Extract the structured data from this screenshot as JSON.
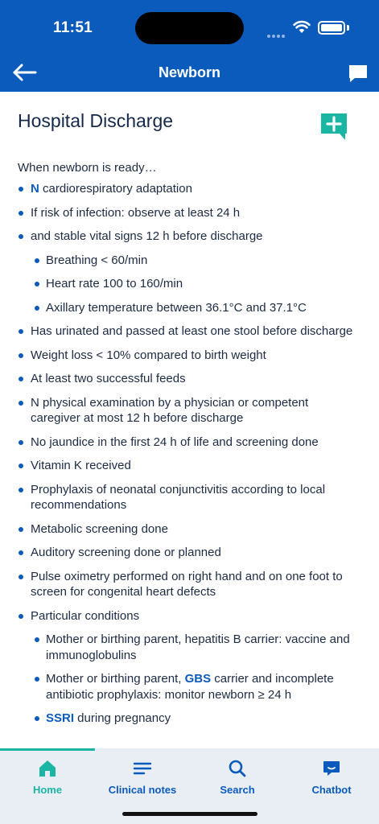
{
  "status_bar": {
    "time": "11:51"
  },
  "nav": {
    "title": "Newborn"
  },
  "page": {
    "title": "Hospital Discharge",
    "intro": "When newborn is ready…",
    "items": [
      {
        "level": 1,
        "keyword": "N",
        "text": " cardiorespiratory adaptation"
      },
      {
        "level": 1,
        "text": "If risk of infection: observe at least 24 h"
      },
      {
        "level": 1,
        "text": "and stable vital signs 12 h before discharge"
      },
      {
        "level": 2,
        "text": "Breathing < 60/min"
      },
      {
        "level": 2,
        "text": "Heart rate 100 to 160/min"
      },
      {
        "level": 2,
        "text": "Axillary temperature between 36.1°C and 37.1°C"
      },
      {
        "level": 1,
        "text": "Has urinated and passed at least one stool before discharge"
      },
      {
        "level": 1,
        "text": "Weight loss < 10% compared to birth weight"
      },
      {
        "level": 1,
        "text": "At least two successful feeds"
      },
      {
        "level": 1,
        "text": "N physical examination by a physician or competent caregiver at most 12 h before discharge"
      },
      {
        "level": 1,
        "text": "No jaundice in the first 24 h of life and screening done"
      },
      {
        "level": 1,
        "text": "Vitamin K received"
      },
      {
        "level": 1,
        "text": "Prophylaxis of neonatal conjunctivitis according to local recommendations"
      },
      {
        "level": 1,
        "text": "Metabolic screening done"
      },
      {
        "level": 1,
        "text": "Auditory screening done or planned"
      },
      {
        "level": 1,
        "text": "Pulse oximetry performed on right hand and on one foot to screen for congenital heart defects"
      },
      {
        "level": 1,
        "text": "Particular conditions"
      },
      {
        "level": 2,
        "text": "Mother or birthing parent, hepatitis B carrier: vaccine and immunoglobulins"
      },
      {
        "level": 2,
        "prefix": "Mother or birthing parent, ",
        "keyword": "GBS",
        "text": " carrier and incomplete antibiotic prophylaxis: monitor newborn ≥ 24 h"
      },
      {
        "level": 2,
        "keyword": "SSRI",
        "text": " during pregnancy"
      }
    ]
  },
  "tabs": [
    {
      "label": "Home",
      "icon": "home-icon",
      "active": true
    },
    {
      "label": "Clinical notes",
      "icon": "notes-icon",
      "active": false
    },
    {
      "label": "Search",
      "icon": "search-icon",
      "active": false
    },
    {
      "label": "Chatbot",
      "icon": "chat-icon",
      "active": false
    }
  ],
  "colors": {
    "header": "#0b5bbd",
    "accent": "#1bb6a3",
    "keyword": "#0b5bbd",
    "tabbar": "#e9eef5"
  }
}
